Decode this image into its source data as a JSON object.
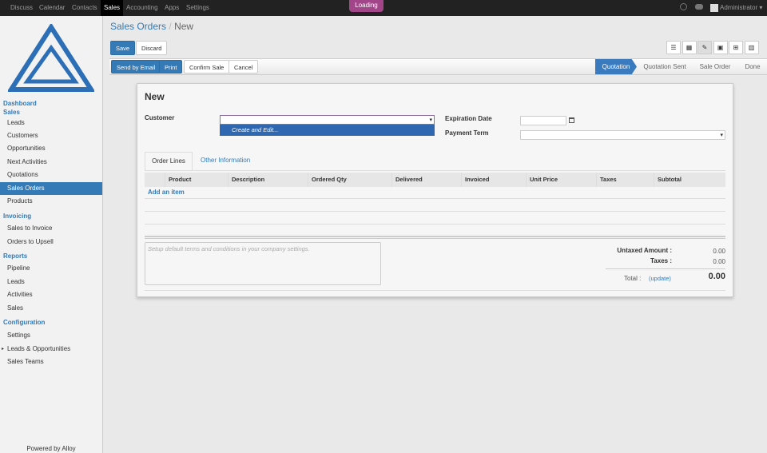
{
  "topbar": {
    "menu": [
      "Discuss",
      "Calendar",
      "Contacts",
      "Sales",
      "Accounting",
      "Apps",
      "Settings"
    ],
    "active": "Sales",
    "loading": "Loading",
    "user": "Administrator"
  },
  "sidebar": {
    "items": [
      {
        "label": "Dashboard",
        "type": "head"
      },
      {
        "label": "Sales",
        "type": "head"
      },
      {
        "label": "Leads"
      },
      {
        "label": "Customers"
      },
      {
        "label": "Opportunities"
      },
      {
        "label": "Next Activities"
      },
      {
        "label": "Quotations"
      },
      {
        "label": "Sales Orders",
        "active": true
      },
      {
        "label": "Products"
      },
      {
        "label": "Invoicing",
        "type": "head"
      },
      {
        "label": "Sales to Invoice"
      },
      {
        "label": "Orders to Upsell"
      },
      {
        "label": "Reports",
        "type": "head"
      },
      {
        "label": "Pipeline"
      },
      {
        "label": "Leads"
      },
      {
        "label": "Activities"
      },
      {
        "label": "Sales"
      },
      {
        "label": "Configuration",
        "type": "head"
      },
      {
        "label": "Settings"
      },
      {
        "label": "Leads & Opportunities",
        "expandable": true
      },
      {
        "label": "Sales Teams"
      }
    ],
    "footer": "Powered by Alloy"
  },
  "breadcrumb": {
    "parent": "Sales Orders",
    "sep": "/",
    "current": "New"
  },
  "buttons": {
    "save": "Save",
    "discard": "Discard",
    "send_email": "Send by Email",
    "print": "Print",
    "confirm": "Confirm Sale",
    "cancel": "Cancel"
  },
  "views": [
    "list-icon",
    "kanban-icon",
    "form-icon",
    "calendar-icon",
    "pivot-icon",
    "graph-icon"
  ],
  "stages": [
    "Quotation",
    "Quotation Sent",
    "Sale Order",
    "Done"
  ],
  "active_stage": "Quotation",
  "form": {
    "title": "New",
    "customer_label": "Customer",
    "customer_value": "",
    "dropdown_option": "Create and Edit...",
    "expiration_label": "Expiration Date",
    "payment_label": "Payment Term",
    "tabs": [
      "Order Lines",
      "Other Information"
    ],
    "columns": [
      "Product",
      "Description",
      "Ordered Qty",
      "Delivered",
      "Invoiced",
      "Unit Price",
      "Taxes",
      "Subtotal"
    ],
    "add_item": "Add an item",
    "terms_placeholder": "Setup default terms and conditions in your company settings.",
    "untaxed_label": "Untaxed Amount :",
    "untaxed": "0.00",
    "taxes_label": "Taxes :",
    "taxes": "0.00",
    "total_label": "Total :",
    "update": "(update)",
    "total": "0.00"
  },
  "colors": {
    "accent": "#337ab7",
    "topbar": "#222222",
    "loading": "#a24689"
  }
}
